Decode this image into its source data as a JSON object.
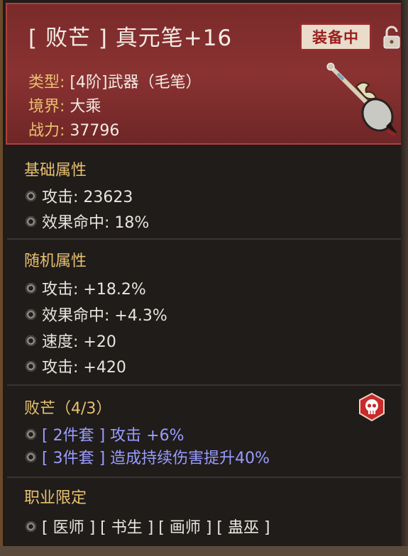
{
  "header": {
    "title": "[ 败芒 ] 真元笔+16",
    "equipped_label": "装备中",
    "type_key": "类型:",
    "type_value": "[4阶]武器（毛笔）",
    "realm_key": "境界:",
    "realm_value": "大乘",
    "power_key": "战力:",
    "power_value": "37796"
  },
  "base": {
    "title": "基础属性",
    "stats": [
      "攻击: 23623",
      "效果命中: 18%"
    ]
  },
  "random": {
    "title": "随机属性",
    "stats": [
      "攻击: +18.2%",
      "效果命中: +4.3%",
      "速度: +20",
      "攻击: +420"
    ]
  },
  "set": {
    "title": "败芒（4/3）",
    "bonuses": [
      "[ 2件套 ] 攻击 +6%",
      "[ 3件套 ] 造成持续伤害提升40%"
    ]
  },
  "class_limit": {
    "title": "职业限定",
    "value": "[ 医师 ] [ 书生 ] [ 画师 ] [ 蛊巫 ]"
  },
  "icons": {
    "lock": "lock-icon",
    "weapon": "brush-weapon-icon",
    "skull": "skull-icon",
    "bullet": "bullet-icon"
  },
  "colors": {
    "header_bg": "#7a2a2a",
    "label_gold": "#e8c070",
    "set_text": "#9a9cff",
    "equipped_red": "#9a1e1e"
  }
}
